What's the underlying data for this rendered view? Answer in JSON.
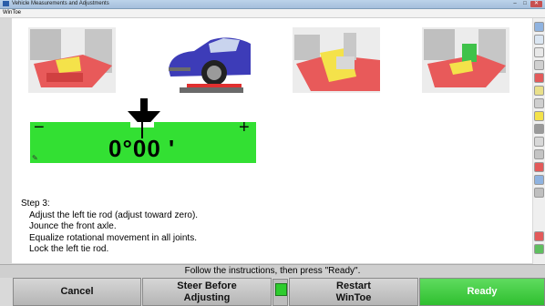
{
  "window": {
    "title": "Vehicle Measurements and Adjustments",
    "menu_item": "WinToe",
    "controls": {
      "minimize": "–",
      "maximize": "□",
      "close": "✕"
    }
  },
  "photos": [
    {
      "name": "suspension-arm-photo-1"
    },
    {
      "name": "vehicle-on-lift-photo"
    },
    {
      "name": "tie-rod-photo"
    },
    {
      "name": "suspension-arm-photo-2"
    }
  ],
  "gauge": {
    "minus_label": "−",
    "plus_label": "+",
    "reading": "0°00 '",
    "value_degrees": 0,
    "colors": {
      "in_tolerance": "#33e033"
    }
  },
  "instructions": {
    "step_label": "Step 3:",
    "lines": [
      "Adjust the left tie rod (adjust toward zero).",
      "Jounce the front axle.",
      "Equalize rotational movement in all joints.",
      "Lock the left tie rod."
    ]
  },
  "status": {
    "message": "Follow the instructions, then press \"Ready\"."
  },
  "buttons": {
    "cancel": "Cancel",
    "steer_before_line1": "Steer Before",
    "steer_before_line2": "Adjusting",
    "restart_line1": "Restart",
    "restart_line2": "WinToe",
    "ready": "Ready"
  },
  "toolbar_icons": [
    "help-icon",
    "vehicle-top-icon",
    "arc-icon",
    "wheel-icon",
    "lift-icon",
    "alignment-icon",
    "rotate-icon",
    "wheel-icon",
    "tire-icon",
    "measure-icon",
    "arc-icon",
    "tire-icon",
    "axle-icon",
    "chart-icon",
    "network-icon"
  ]
}
